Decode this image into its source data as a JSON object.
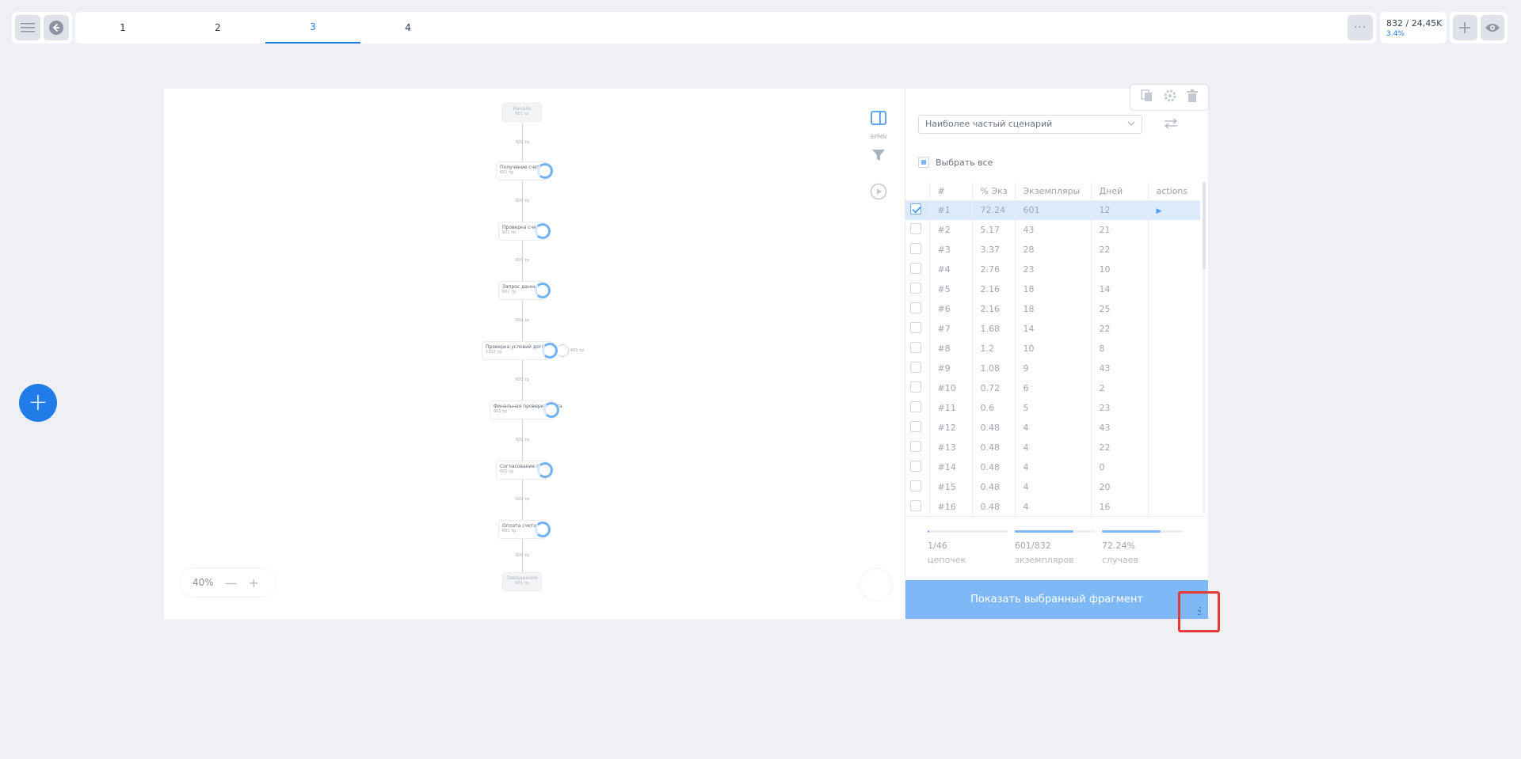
{
  "tabs": [
    "1",
    "2",
    "3",
    "4"
  ],
  "active_tab": 2,
  "stats": {
    "main": "832 / 24,45K",
    "sub": "3.4%"
  },
  "flow": {
    "start": {
      "name": "Начало",
      "count": "601 тр"
    },
    "end": {
      "name": "Завершение",
      "count": "601 тр"
    },
    "steps": [
      {
        "name": "Получение счета",
        "count": "601 тр"
      },
      {
        "name": "Проверка счета",
        "count": "601 тр"
      },
      {
        "name": "Запрос данных",
        "count": "601 тр"
      },
      {
        "name": "Проверка условий договора",
        "count": "1202 тр"
      },
      {
        "name": "Финальная проверка счета",
        "count": "601 тр"
      },
      {
        "name": "Согласование счета",
        "count": "601 тр"
      },
      {
        "name": "Оплата счета",
        "count": "601 тр"
      }
    ],
    "edge_label": "601 тр",
    "loop_label": "601 тр"
  },
  "tools": {
    "bpmn": "BPMN"
  },
  "zoom": {
    "level": "40%",
    "minus": "—",
    "plus": "+"
  },
  "panel": {
    "select_value": "Наиболее частый сценарий",
    "select_all": "Выбрать все",
    "columns": [
      "#",
      "% Экз",
      "Экземпляры",
      "Дней",
      "actions"
    ],
    "rows": [
      {
        "id": "#1",
        "pct": "72.24",
        "inst": "601",
        "days": "12",
        "selected": true
      },
      {
        "id": "#2",
        "pct": "5.17",
        "inst": "43",
        "days": "21"
      },
      {
        "id": "#3",
        "pct": "3.37",
        "inst": "28",
        "days": "22"
      },
      {
        "id": "#4",
        "pct": "2.76",
        "inst": "23",
        "days": "10"
      },
      {
        "id": "#5",
        "pct": "2.16",
        "inst": "18",
        "days": "14"
      },
      {
        "id": "#6",
        "pct": "2.16",
        "inst": "18",
        "days": "25"
      },
      {
        "id": "#7",
        "pct": "1.68",
        "inst": "14",
        "days": "22"
      },
      {
        "id": "#8",
        "pct": "1.2",
        "inst": "10",
        "days": "8"
      },
      {
        "id": "#9",
        "pct": "1.08",
        "inst": "9",
        "days": "43"
      },
      {
        "id": "#10",
        "pct": "0.72",
        "inst": "6",
        "days": "2"
      },
      {
        "id": "#11",
        "pct": "0.6",
        "inst": "5",
        "days": "23"
      },
      {
        "id": "#12",
        "pct": "0.48",
        "inst": "4",
        "days": "43"
      },
      {
        "id": "#13",
        "pct": "0.48",
        "inst": "4",
        "days": "22"
      },
      {
        "id": "#14",
        "pct": "0.48",
        "inst": "4",
        "days": "0"
      },
      {
        "id": "#15",
        "pct": "0.48",
        "inst": "4",
        "days": "20"
      },
      {
        "id": "#16",
        "pct": "0.48",
        "inst": "4",
        "days": "16"
      }
    ],
    "meters": [
      {
        "value": "1/46",
        "label": "цепочек",
        "fraction": 0.022
      },
      {
        "value": "601/832",
        "label": "экземпляров",
        "fraction": 0.722
      },
      {
        "value": "72.24%",
        "label": "случаев",
        "fraction": 0.722
      }
    ],
    "show_button": "Показать выбранный фрагмент"
  },
  "fab_label": "+"
}
